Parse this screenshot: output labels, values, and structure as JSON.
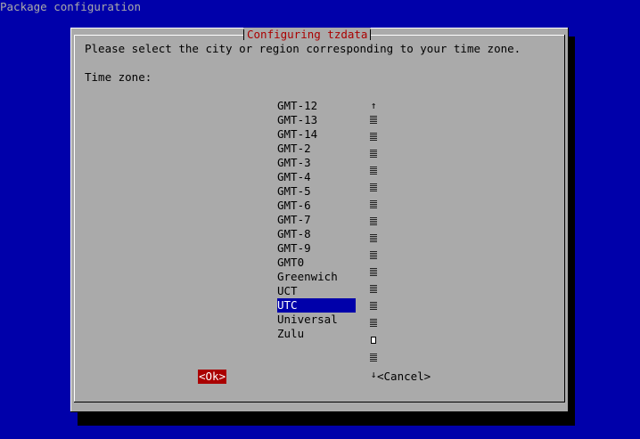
{
  "window_title": "Package configuration",
  "dialog": {
    "title": "Configuring tzdata",
    "prompt": "Please select the city or region corresponding to your time zone.",
    "field_label": "Time zone:"
  },
  "timezones": [
    {
      "label": "GMT-12",
      "selected": false
    },
    {
      "label": "GMT-13",
      "selected": false
    },
    {
      "label": "GMT-14",
      "selected": false
    },
    {
      "label": "GMT-2",
      "selected": false
    },
    {
      "label": "GMT-3",
      "selected": false
    },
    {
      "label": "GMT-4",
      "selected": false
    },
    {
      "label": "GMT-5",
      "selected": false
    },
    {
      "label": "GMT-6",
      "selected": false
    },
    {
      "label": "GMT-7",
      "selected": false
    },
    {
      "label": "GMT-8",
      "selected": false
    },
    {
      "label": "GMT-9",
      "selected": false
    },
    {
      "label": "GMT0",
      "selected": false
    },
    {
      "label": "Greenwich",
      "selected": false
    },
    {
      "label": "UCT",
      "selected": false
    },
    {
      "label": "UTC",
      "selected": true
    },
    {
      "label": "Universal",
      "selected": false
    },
    {
      "label": "Zulu",
      "selected": false
    }
  ],
  "scrollbar": {
    "up_arrow": "↑",
    "down_arrow": "↓",
    "thumb_index": 14
  },
  "buttons": {
    "ok": "<Ok>",
    "cancel": "<Cancel>"
  },
  "colors": {
    "background": "#0000aa",
    "dialog": "#aaaaaa",
    "title": "#aa0000",
    "selection": "#0000aa",
    "ok_button": "#aa0000"
  }
}
